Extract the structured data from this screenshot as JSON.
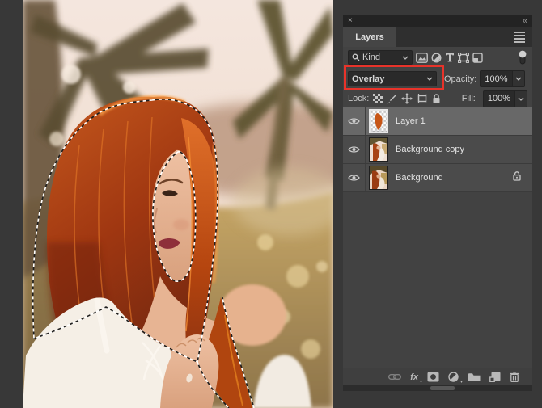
{
  "panel": {
    "close_glyph": "×",
    "collapse_glyph": "«",
    "tab_label": "Layers",
    "filter": {
      "kind_label": "Kind"
    },
    "blend": {
      "mode": "Overlay",
      "opacity_label": "Opacity:",
      "opacity_value": "100%"
    },
    "lock": {
      "label": "Lock:",
      "fill_label": "Fill:",
      "fill_value": "100%"
    },
    "layers": [
      {
        "name": "Layer 1",
        "selected": true,
        "locked": false
      },
      {
        "name": "Background copy",
        "selected": false,
        "locked": false
      },
      {
        "name": "Background",
        "selected": false,
        "locked": true
      }
    ],
    "toolbar": {
      "fx_label": "fx"
    }
  },
  "canvas": {
    "description": "Portrait of a woman with long red hair in a white eyelet top among palm trees at golden hour; the hair is selected with a marching-ants selection"
  },
  "annotation": {
    "highlight_color": "#e8332a"
  },
  "icons": {
    "filter_icons": [
      "pixel-layer-filter",
      "adjustment-layer-filter",
      "type-layer-filter",
      "shape-layer-filter",
      "smart-object-filter",
      "filter-toggle"
    ],
    "lock_icons": [
      "lock-transparency",
      "lock-pixels",
      "lock-position",
      "lock-artboard",
      "lock-all"
    ],
    "toolbar_icons": [
      "link-layers",
      "layer-style-fx",
      "add-layer-mask",
      "new-adjustment-layer",
      "new-group",
      "new-layer",
      "delete-layer"
    ],
    "dropdown_arrow": "▾"
  }
}
